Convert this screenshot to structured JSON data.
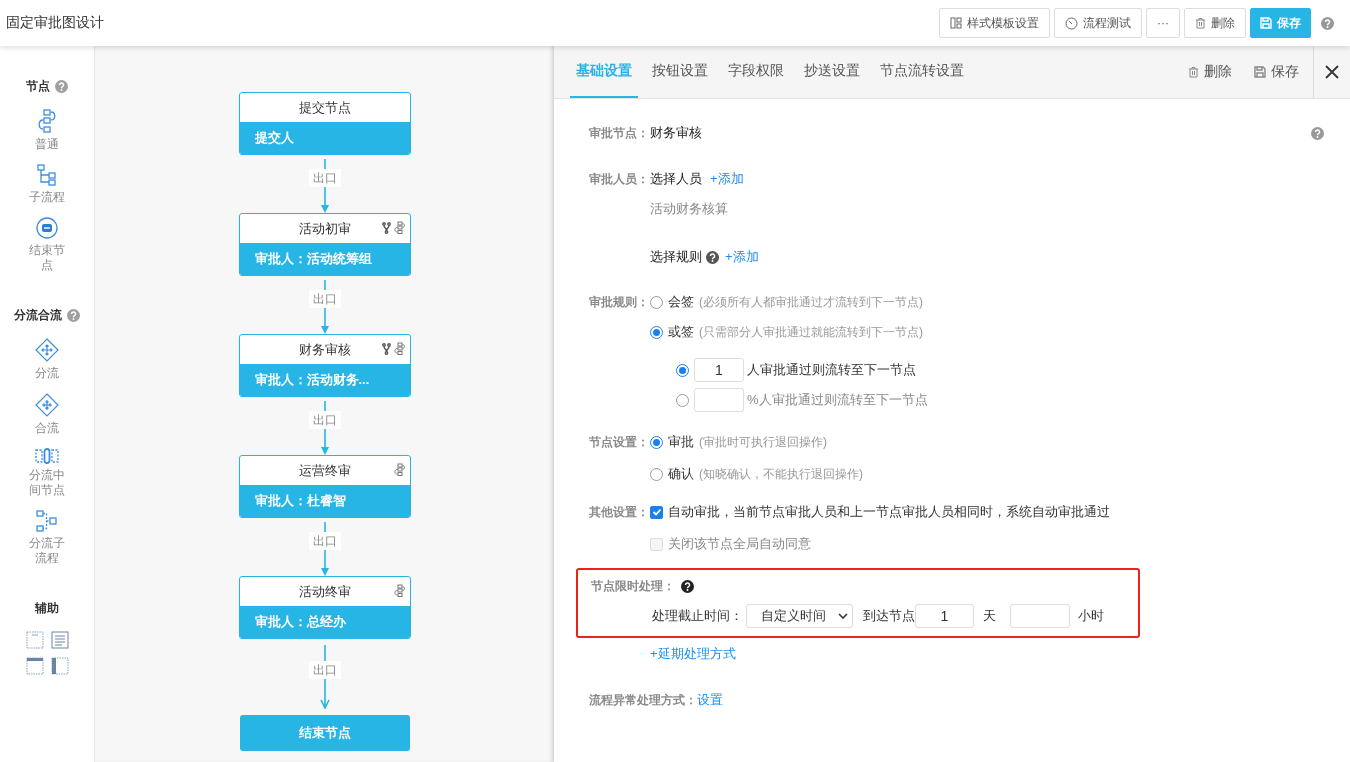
{
  "header": {
    "title": "固定审批图设计",
    "buttons": [
      {
        "label": "样式模板设置",
        "kind": "template",
        "primary": false
      },
      {
        "label": "流程测试",
        "kind": "test",
        "primary": false
      },
      {
        "label": "···",
        "kind": "more",
        "primary": false
      },
      {
        "label": "删除",
        "kind": "delete",
        "primary": false
      },
      {
        "label": "保存",
        "kind": "save",
        "primary": true
      }
    ],
    "help": true
  },
  "palette": {
    "groups": [
      {
        "title": "节点",
        "help": true,
        "kind": "list",
        "items": [
          {
            "label": "普通",
            "kind": "normal"
          },
          {
            "label": "子流程",
            "kind": "subflow"
          },
          {
            "label": "结束节点",
            "kind": "end"
          }
        ]
      },
      {
        "title": "分流合流",
        "help": true,
        "kind": "list",
        "items": [
          {
            "label": "分流",
            "kind": "split"
          },
          {
            "label": "合流",
            "kind": "merge"
          },
          {
            "label": "分流中间节点",
            "kind": "middle"
          },
          {
            "label": "分流子流程",
            "kind": "branchflow"
          }
        ]
      },
      {
        "title": "辅助",
        "help": false,
        "kind": "grid",
        "items": [
          {
            "kind": "header-box"
          },
          {
            "kind": "text-box"
          },
          {
            "kind": "title-bar"
          },
          {
            "kind": "side-bar"
          }
        ]
      }
    ]
  },
  "flow": {
    "nodes": [
      {
        "kind": "start",
        "title": "提交节点",
        "assignee": "提交人",
        "branch": false,
        "link": false,
        "exit": "出口"
      },
      {
        "kind": "approval",
        "title": "活动初审",
        "assignee": "审批人：活动统筹组",
        "branch": true,
        "link": true,
        "exit": "出口"
      },
      {
        "kind": "approval",
        "title": "财务审核",
        "assignee": "审批人：活动财务...",
        "branch": true,
        "link": true,
        "exit": "出口"
      },
      {
        "kind": "approval",
        "title": "运营终审",
        "assignee": "审批人：杜睿智",
        "branch": false,
        "link": true,
        "exit": "出口"
      },
      {
        "kind": "approval",
        "title": "活动终审",
        "assignee": "审批人：总经办",
        "branch": false,
        "link": true,
        "exit": "出口"
      },
      {
        "kind": "end",
        "title": "结束节点"
      }
    ]
  },
  "panel": {
    "tabs": [
      {
        "label": "基础设置",
        "selected": true
      },
      {
        "label": "按钮设置",
        "selected": false
      },
      {
        "label": "字段权限",
        "selected": false
      },
      {
        "label": "抄送设置",
        "selected": false
      },
      {
        "label": "节点流转设置",
        "selected": false
      }
    ],
    "actions": [
      {
        "label": "删除",
        "kind": "delete"
      },
      {
        "label": "保存",
        "kind": "save"
      }
    ],
    "node_name": {
      "label": "审批节点：",
      "value": "财务审核"
    },
    "approvers": {
      "label": "审批人员：",
      "select_people": "选择人员",
      "add_people": "+添加",
      "people": [
        "活动财务核算"
      ],
      "select_rule": "选择规则",
      "add_rule": "+添加"
    },
    "rule": {
      "label": "审批规则：",
      "options": [
        {
          "label": "会签",
          "hint": "(必须所有人都审批通过才流转到下一节点)",
          "selected": false
        },
        {
          "label": "或签",
          "hint": "(只需部分人审批通过就能流转到下一节点)",
          "selected": true
        }
      ],
      "sub_options": [
        {
          "value": "1",
          "text": "人审批通过则流转至下一节点",
          "selected": true,
          "disabled": false
        },
        {
          "text": "%人审批通过则流转至下一节点",
          "selected": false,
          "disabled": true
        }
      ]
    },
    "node_setting": {
      "label": "节点设置：",
      "options": [
        {
          "label": "审批",
          "hint": "(审批时可执行退回操作)",
          "selected": true
        },
        {
          "label": "确认",
          "hint": "(知晓确认，不能执行退回操作)",
          "selected": false
        }
      ]
    },
    "other": {
      "label": "其他设置：",
      "checks": [
        {
          "label": "自动审批，当前节点审批人员和上一节点审批人员相同时，系统自动审批通过",
          "checked": true,
          "disabled": false
        },
        {
          "label": "关闭该节点全局自动同意",
          "checked": false,
          "disabled": true
        }
      ]
    },
    "time_limit": {
      "label": "节点限时处理：",
      "highlighted": true,
      "deadline_label": "处理截止时间：",
      "deadline_type": "自定义时间",
      "reach_label": "到达节点",
      "days": "1",
      "days_unit": "天",
      "hours_unit": "小时"
    },
    "delay_link": "+延期处理方式",
    "exception": {
      "label": "流程异常处理方式：",
      "link": "设置"
    }
  }
}
